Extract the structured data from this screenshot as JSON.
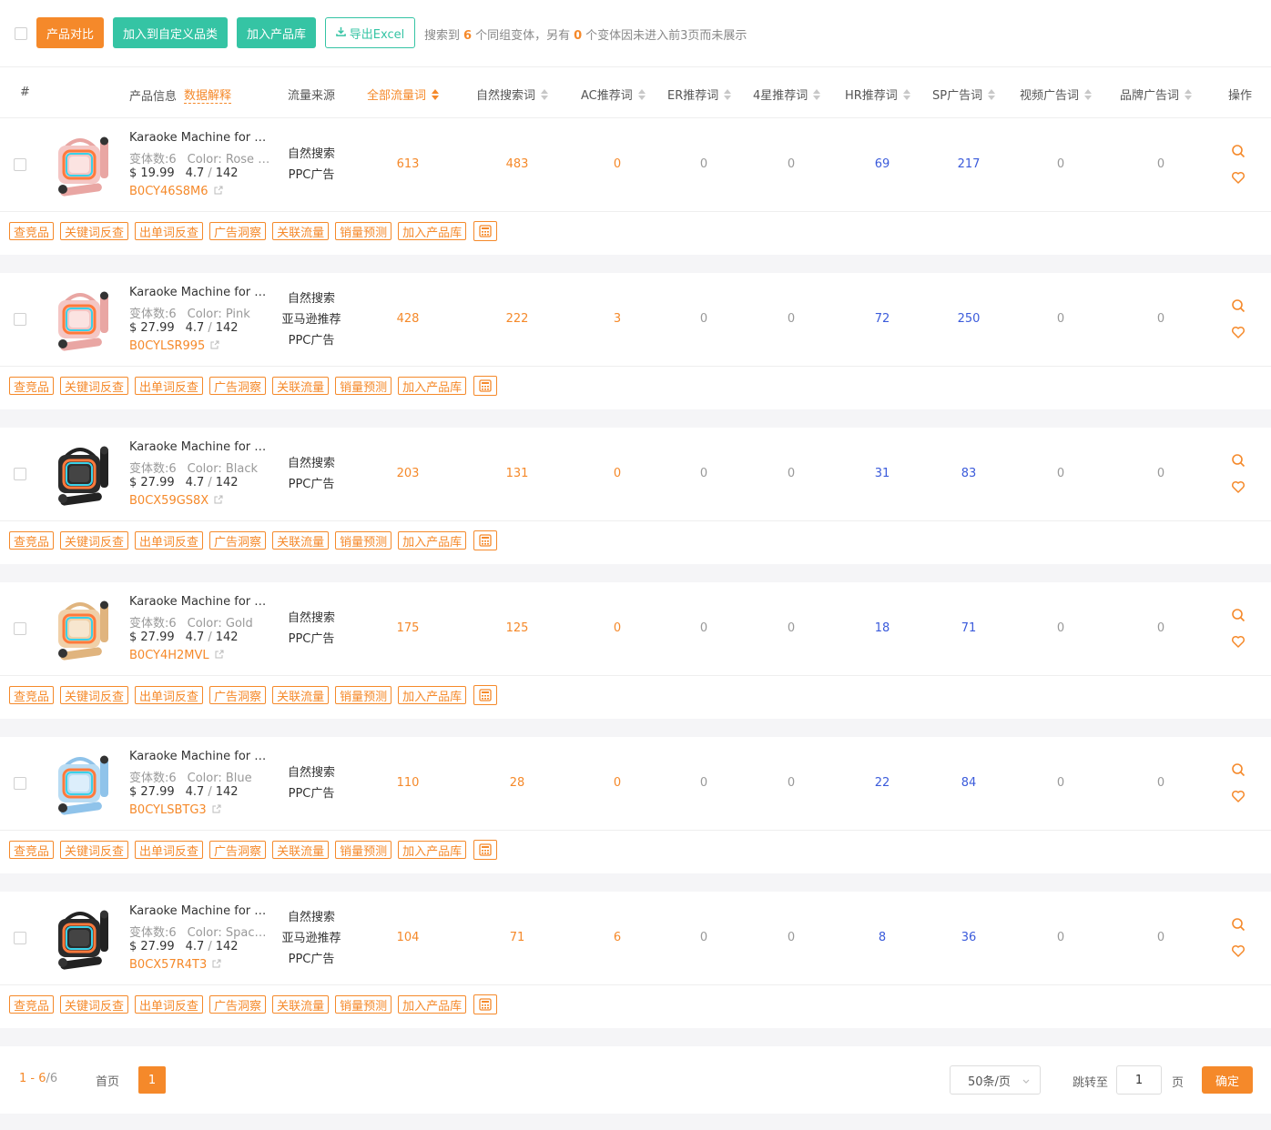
{
  "toolbar": {
    "compare_label": "产品对比",
    "add_category_label": "加入到自定义品类",
    "add_library_label": "加入产品库",
    "export_label": "导出Excel",
    "summary_prefix": "搜索到",
    "variant_count": "6",
    "summary_mid": "个同组变体，另有",
    "hidden_count": "0",
    "summary_suffix": "个变体因未进入前3页而未展示"
  },
  "header": {
    "index": "#",
    "product_info": "产品信息",
    "data_explain": "数据解释",
    "traffic_source": "流量来源",
    "columns": [
      "全部流量词",
      "自然搜索词",
      "AC推荐词",
      "ER推荐词",
      "4星推荐词",
      "HR推荐词",
      "SP广告词",
      "视频广告词",
      "品牌广告词"
    ],
    "ops": "操作"
  },
  "tag_labels": [
    "查竞品",
    "关键词反查",
    "出单词反查",
    "广告洞察",
    "关联流量",
    "销量预测",
    "加入产品库"
  ],
  "colors": {
    "accent": "#f5892a",
    "teal": "#35c4a4",
    "link_blue": "#3b5bdb"
  },
  "rows": [
    {
      "name": "Karaoke Machine for Kids",
      "variants": "变体数:6",
      "color": "Color: Rose Gold",
      "price": "$ 19.99",
      "rating": "4.7",
      "reviews": "142",
      "asin": "B0CY46S8M6",
      "sources": [
        "自然搜索",
        "PPC广告"
      ],
      "stats": [
        "613",
        "483",
        "0",
        "0",
        "0",
        "69",
        "217",
        "0",
        "0"
      ],
      "theme": "pink"
    },
    {
      "name": "Karaoke Machine for Kids",
      "variants": "变体数:6",
      "color": "Color: Pink",
      "price": "$ 27.99",
      "rating": "4.7",
      "reviews": "142",
      "asin": "B0CYLSR995",
      "sources": [
        "自然搜索",
        "亚马逊推荐",
        "PPC广告"
      ],
      "stats": [
        "428",
        "222",
        "3",
        "0",
        "0",
        "72",
        "250",
        "0",
        "0"
      ],
      "theme": "pink"
    },
    {
      "name": "Karaoke Machine for Kids",
      "variants": "变体数:6",
      "color": "Color: Black",
      "price": "$ 27.99",
      "rating": "4.7",
      "reviews": "142",
      "asin": "B0CX59GS8X",
      "sources": [
        "自然搜索",
        "PPC广告"
      ],
      "stats": [
        "203",
        "131",
        "0",
        "0",
        "0",
        "31",
        "83",
        "0",
        "0"
      ],
      "theme": "black"
    },
    {
      "name": "Karaoke Machine for Kids",
      "variants": "变体数:6",
      "color": "Color: Gold",
      "price": "$ 27.99",
      "rating": "4.7",
      "reviews": "142",
      "asin": "B0CY4H2MVL",
      "sources": [
        "自然搜索",
        "PPC广告"
      ],
      "stats": [
        "175",
        "125",
        "0",
        "0",
        "0",
        "18",
        "71",
        "0",
        "0"
      ],
      "theme": "gold"
    },
    {
      "name": "Karaoke Machine for Kids",
      "variants": "变体数:6",
      "color": "Color: Blue",
      "price": "$ 27.99",
      "rating": "4.7",
      "reviews": "142",
      "asin": "B0CYLSBTG3",
      "sources": [
        "自然搜索",
        "PPC广告"
      ],
      "stats": [
        "110",
        "28",
        "0",
        "0",
        "0",
        "22",
        "84",
        "0",
        "0"
      ],
      "theme": "blue"
    },
    {
      "name": "Karaoke Machine for Kids",
      "variants": "变体数:6",
      "color": "Color: Space Black",
      "price": "$ 27.99",
      "rating": "4.7",
      "reviews": "142",
      "asin": "B0CX57R4T3",
      "sources": [
        "自然搜索",
        "亚马逊推荐",
        "PPC广告"
      ],
      "stats": [
        "104",
        "71",
        "6",
        "0",
        "0",
        "8",
        "36",
        "0",
        "0"
      ],
      "theme": "black"
    }
  ],
  "pagination": {
    "range": "1 - 6",
    "total": "/6",
    "first_label": "首页",
    "current_page": "1",
    "page_size": "50条/页",
    "goto_label": "跳转至",
    "goto_value": "1",
    "page_unit": "页",
    "confirm_label": "确定"
  }
}
